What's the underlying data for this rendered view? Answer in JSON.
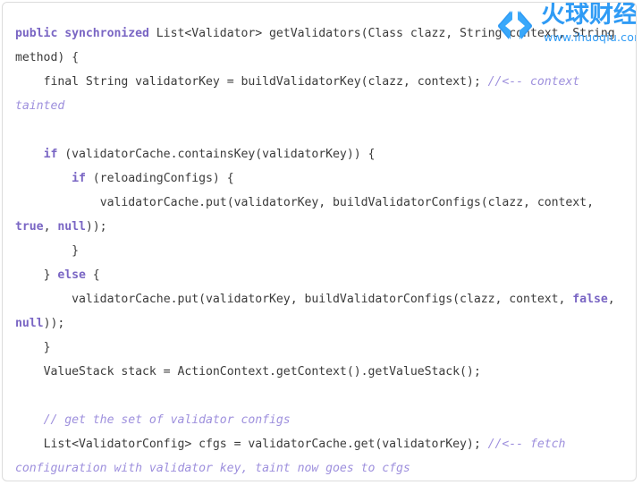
{
  "panel": {
    "name": "code-snippet-panel",
    "background": "#ffffff",
    "border_color": "#dcdcdc"
  },
  "theme": {
    "keyword_color": "#7a66c4",
    "comment_color": "#9e90dd",
    "plain_color": "#3b3b3b",
    "watermark_color": "#2f9bf5"
  },
  "code": {
    "language": "java",
    "lines": [
      {
        "id": "line-1",
        "tokens": [
          {
            "t": "kw",
            "v": "public synchronized"
          },
          {
            "t": "pln",
            "v": " List<Validator> getValidators(Class clazz, String context, String method) {"
          }
        ]
      },
      {
        "id": "line-2",
        "tokens": [
          {
            "t": "pln",
            "v": "    final String validatorKey = buildValidatorKey(clazz, context); "
          },
          {
            "t": "cmt",
            "v": "//<-- context tainted"
          }
        ]
      },
      {
        "id": "line-3",
        "blank": true,
        "tokens": []
      },
      {
        "id": "line-4",
        "tokens": [
          {
            "t": "pln",
            "v": "    "
          },
          {
            "t": "kw",
            "v": "if"
          },
          {
            "t": "pln",
            "v": " (validatorCache.containsKey(validatorKey)) {"
          }
        ]
      },
      {
        "id": "line-5",
        "tokens": [
          {
            "t": "pln",
            "v": "        "
          },
          {
            "t": "kw",
            "v": "if"
          },
          {
            "t": "pln",
            "v": " (reloadingConfigs) {"
          }
        ]
      },
      {
        "id": "line-6",
        "tokens": [
          {
            "t": "pln",
            "v": "            validatorCache.put(validatorKey, buildValidatorConfigs(clazz, context, "
          },
          {
            "t": "kw",
            "v": "true"
          },
          {
            "t": "pln",
            "v": ", "
          },
          {
            "t": "kw",
            "v": "null"
          },
          {
            "t": "pln",
            "v": "));"
          }
        ]
      },
      {
        "id": "line-7",
        "tokens": [
          {
            "t": "pln",
            "v": "        }"
          }
        ]
      },
      {
        "id": "line-8",
        "tokens": [
          {
            "t": "pln",
            "v": "    } "
          },
          {
            "t": "kw",
            "v": "else"
          },
          {
            "t": "pln",
            "v": " {"
          }
        ]
      },
      {
        "id": "line-9",
        "tokens": [
          {
            "t": "pln",
            "v": "        validatorCache.put(validatorKey, buildValidatorConfigs(clazz, context, "
          },
          {
            "t": "kw",
            "v": "false"
          },
          {
            "t": "pln",
            "v": ", "
          },
          {
            "t": "kw",
            "v": "null"
          },
          {
            "t": "pln",
            "v": "));"
          }
        ]
      },
      {
        "id": "line-10",
        "tokens": [
          {
            "t": "pln",
            "v": "    }"
          }
        ]
      },
      {
        "id": "line-11",
        "tokens": [
          {
            "t": "pln",
            "v": "    ValueStack stack = ActionContext.getContext().getValueStack();"
          }
        ]
      },
      {
        "id": "line-12",
        "blank": true,
        "tokens": []
      },
      {
        "id": "line-13",
        "tokens": [
          {
            "t": "pln",
            "v": "    "
          },
          {
            "t": "cmt",
            "v": "// get the set of validator configs"
          }
        ]
      },
      {
        "id": "line-14",
        "tokens": [
          {
            "t": "pln",
            "v": "    List<ValidatorConfig> cfgs = validatorCache.get(validatorKey); "
          },
          {
            "t": "cmt",
            "v": "//<-- fetch configuration with validator key, taint now goes to cfgs"
          }
        ]
      }
    ]
  },
  "watermark": {
    "name": "site-watermark",
    "brand_cn": "火球财经",
    "url": "www.ihuoqiu.com",
    "logo_icon": "double-chevron-quote-icon"
  }
}
